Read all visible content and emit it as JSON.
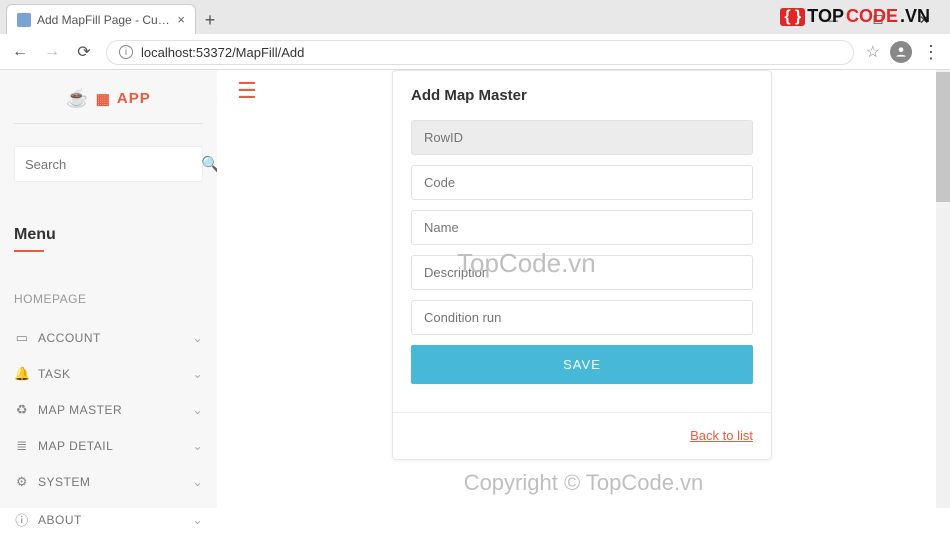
{
  "browser": {
    "tab_title": "Add MapFill Page - Customer Ca",
    "url": "localhost:53372/MapFill/Add"
  },
  "watermark": {
    "brand_left": "TOP",
    "brand_right": "CODE",
    "brand_suffix": ".VN",
    "center": "TopCode.vn",
    "footer": "Copyright © TopCode.vn"
  },
  "sidebar": {
    "app_name": "APP",
    "search_placeholder": "Search",
    "menu_heading": "Menu",
    "items": [
      {
        "label": "HOMEPAGE",
        "icon": "",
        "expandable": false
      },
      {
        "label": "ACCOUNT",
        "icon": "▭",
        "expandable": true
      },
      {
        "label": "TASK",
        "icon": "🔔",
        "expandable": true
      },
      {
        "label": "MAP MASTER",
        "icon": "♻",
        "expandable": true
      },
      {
        "label": "MAP DETAIL",
        "icon": "≣",
        "expandable": true
      },
      {
        "label": "SYSTEM",
        "icon": "⚙",
        "expandable": true
      },
      {
        "label": "ABOUT",
        "icon": "ⓘ",
        "expandable": true
      }
    ]
  },
  "form": {
    "title": "Add Map Master",
    "fields": {
      "rowid": "RowID",
      "code": "Code",
      "name": "Name",
      "description": "Description",
      "condition": "Condition run"
    },
    "save_label": "SAVE",
    "back_label": "Back to list"
  }
}
